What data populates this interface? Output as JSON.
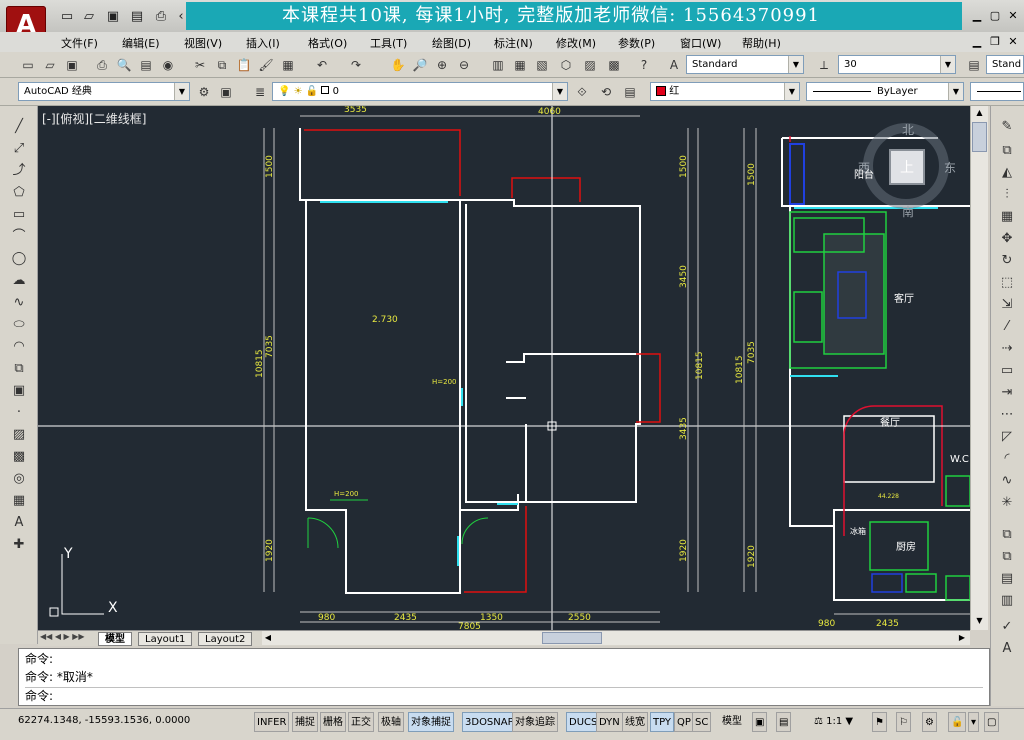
{
  "window": {
    "app_logo": "A",
    "banner_text": "本课程共10课, 每课1小时, 完整版加老师微信: 15564370991"
  },
  "menus": [
    "文件(F)",
    "编辑(E)",
    "视图(V)",
    "插入(I)",
    "格式(O)",
    "工具(T)",
    "绘图(D)",
    "标注(N)",
    "修改(M)",
    "参数(P)",
    "窗口(W)",
    "帮助(H)"
  ],
  "toolbar": {
    "text_style": "Standard",
    "dim_value": "30",
    "dim_style_partial": "Stand"
  },
  "properties": {
    "workspace": "AutoCAD 经典",
    "layer": "0",
    "color_label": "红",
    "color_hex": "#e0001a",
    "linetype": "ByLayer"
  },
  "viewport": {
    "label": "[-][俯视][二维线框]",
    "ucs_x": "X",
    "ucs_y": "Y"
  },
  "viewcube": {
    "north": "北",
    "south": "南",
    "east": "东",
    "west": "西",
    "face": "上"
  },
  "plan_left": {
    "top_dims": [
      "3535",
      "4060"
    ],
    "left_dims": [
      "1500",
      "7035",
      "10815",
      "1920"
    ],
    "right_dims": [
      "1500",
      "3450",
      "10815",
      "3435",
      "1920"
    ],
    "bottom_dims": [
      "980",
      "2435",
      "1350",
      "2550"
    ],
    "total_bottom": "7805",
    "elev_label": "2.730",
    "h_label_1": "H=200",
    "h_label_2": "H=200"
  },
  "plan_right": {
    "left_dims": [
      "1500",
      "10815",
      "7035",
      "1920"
    ],
    "bottom_dims": [
      "980",
      "2435"
    ],
    "rooms": [
      "阳台",
      "客厅",
      "餐厅",
      "W.C",
      "厨房",
      "冰箱"
    ],
    "small_label": "44.228"
  },
  "tabs": [
    "模型",
    "Layout1",
    "Layout2"
  ],
  "command": {
    "lines": [
      "命令:",
      "命令: *取消*",
      "命令:"
    ]
  },
  "status": {
    "coords": "62274.1348, -15593.1536, 0.0000",
    "toggles": [
      {
        "label": "INFER",
        "on": false
      },
      {
        "label": "捕捉",
        "on": false
      },
      {
        "label": "栅格",
        "on": false
      },
      {
        "label": "正交",
        "on": false
      },
      {
        "label": "极轴",
        "on": false
      },
      {
        "label": "对象捕捉",
        "on": true
      },
      {
        "label": "3DOSNAP",
        "on": true
      },
      {
        "label": "对象追踪",
        "on": false
      },
      {
        "label": "DUCS",
        "on": true
      },
      {
        "label": "DYN",
        "on": false
      },
      {
        "label": "线宽",
        "on": false
      },
      {
        "label": "TPY",
        "on": true
      },
      {
        "label": "QP",
        "on": false
      },
      {
        "label": "SC",
        "on": false
      }
    ],
    "model_label": "模型",
    "scale": "1:1"
  }
}
